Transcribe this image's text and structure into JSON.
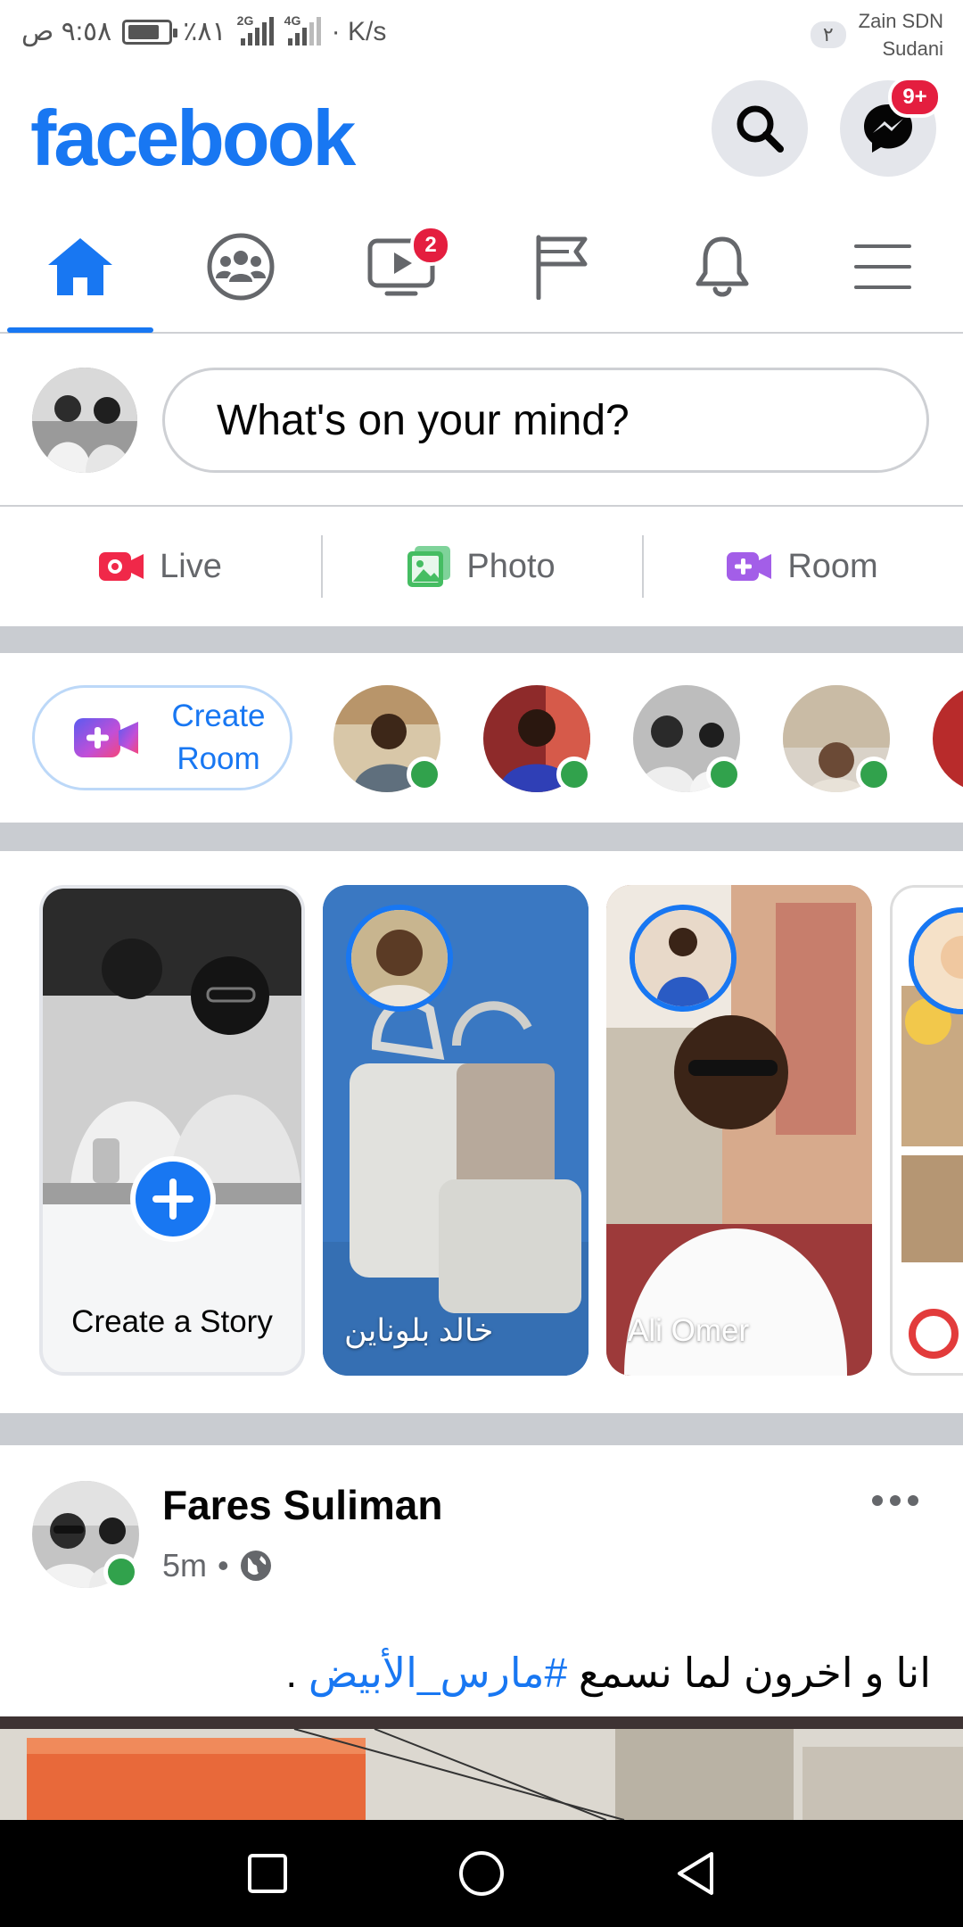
{
  "status_bar": {
    "time": "٩:٥٨ ص",
    "battery": "٪٨١",
    "net_2g": "2G",
    "net_4g": "4G",
    "speed": "· K/s",
    "sim": "٢",
    "carrier_line1": "Zain SDN",
    "carrier_line2": "Sudani"
  },
  "header": {
    "logo": "facebook",
    "messenger_badge": "9+"
  },
  "tabs": [
    {
      "name": "home",
      "icon": "home-icon",
      "active": true
    },
    {
      "name": "groups",
      "icon": "groups-icon"
    },
    {
      "name": "watch",
      "icon": "watch-icon",
      "badge": "2"
    },
    {
      "name": "pages",
      "icon": "flag-icon"
    },
    {
      "name": "notifications",
      "icon": "bell-icon"
    },
    {
      "name": "menu",
      "icon": "menu-icon"
    }
  ],
  "composer": {
    "placeholder": "What's on your mind?"
  },
  "actions": {
    "live": "Live",
    "photo": "Photo",
    "room": "Room"
  },
  "rooms": {
    "create_line1": "Create",
    "create_line2": "Room"
  },
  "stories": {
    "create_label": "Create a Story",
    "items": [
      {
        "name": "خالد بلوناين"
      },
      {
        "name": "Ali Omer"
      }
    ]
  },
  "post": {
    "author": "Fares Suliman",
    "time": "5m",
    "text_prefix": "انا و اخرون لما نسمع",
    "hashtag": "#مارس_الأبيض",
    "text_suffix": " ."
  },
  "colors": {
    "brand": "#1877f2",
    "badge": "#e41e3f",
    "online": "#31a24c",
    "live": "#f02849",
    "photo": "#45bd62",
    "room": "#a35ee8"
  }
}
